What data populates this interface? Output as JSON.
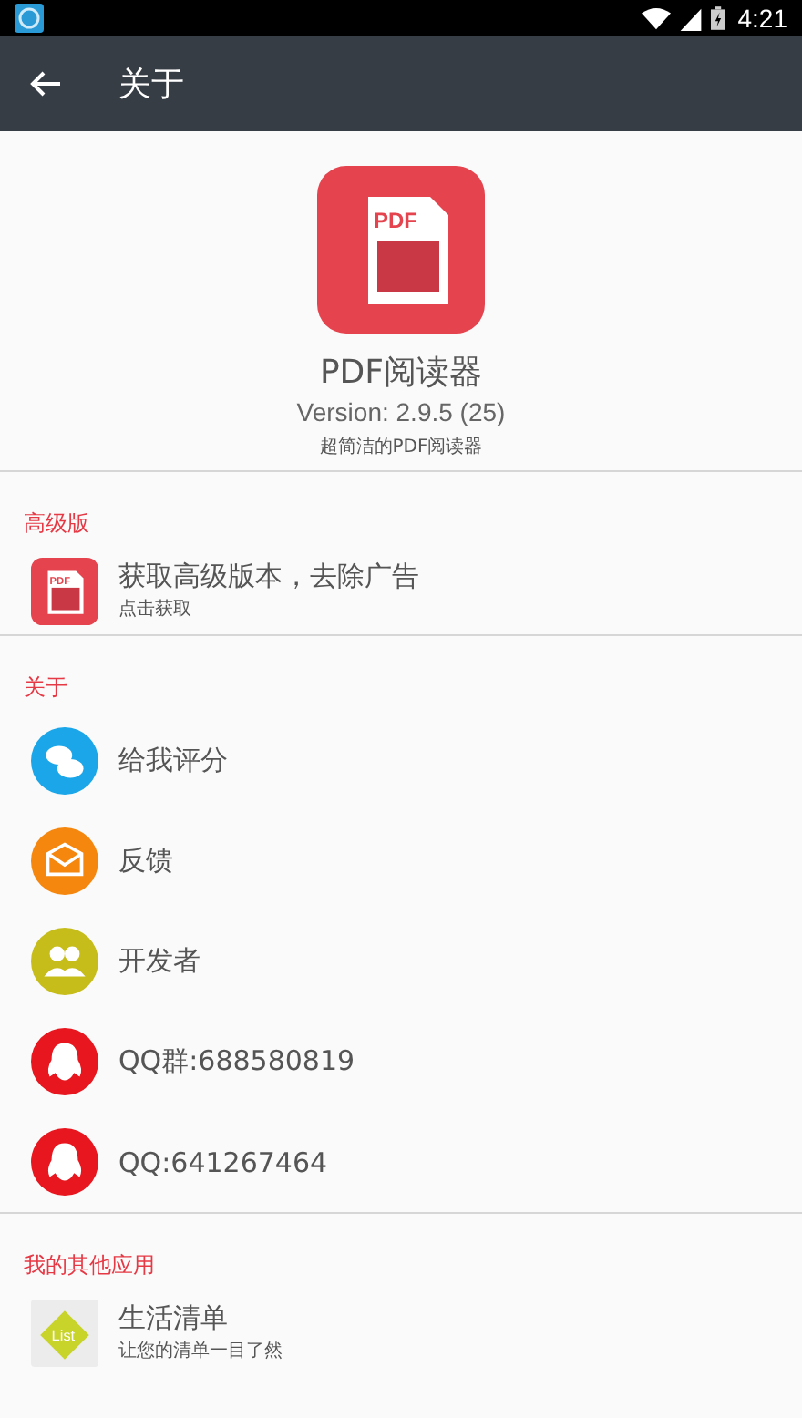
{
  "status_bar": {
    "time": "4:21"
  },
  "app_bar": {
    "title": "关于"
  },
  "header": {
    "icon_text": "PDF",
    "app_name": "PDF阅读器",
    "version": "Version: 2.9.5 (25)",
    "slogan": "超简洁的PDF阅读器"
  },
  "sections": [
    {
      "title": "高级版",
      "items": [
        {
          "kind": "app",
          "icon_text": "PDF",
          "title": "获取高级版本，去除广告",
          "subtitle": "点击获取"
        }
      ]
    },
    {
      "title": "关于",
      "items": [
        {
          "kind": "rate",
          "title": "给我评分",
          "color": "#1aa6e8"
        },
        {
          "kind": "feedback",
          "title": "反馈",
          "color": "#f5870f"
        },
        {
          "kind": "developer",
          "title": "开发者",
          "color": "#c6bd1a"
        },
        {
          "kind": "qq",
          "title": "QQ群:688580819",
          "color": "#e8161e"
        },
        {
          "kind": "qq",
          "title": "QQ:641267464",
          "color": "#e8161e"
        }
      ]
    },
    {
      "title": "我的其他应用",
      "items": [
        {
          "kind": "list",
          "icon_text": "List",
          "title": "生活清单",
          "subtitle": "让您的清单一目了然"
        }
      ]
    }
  ]
}
